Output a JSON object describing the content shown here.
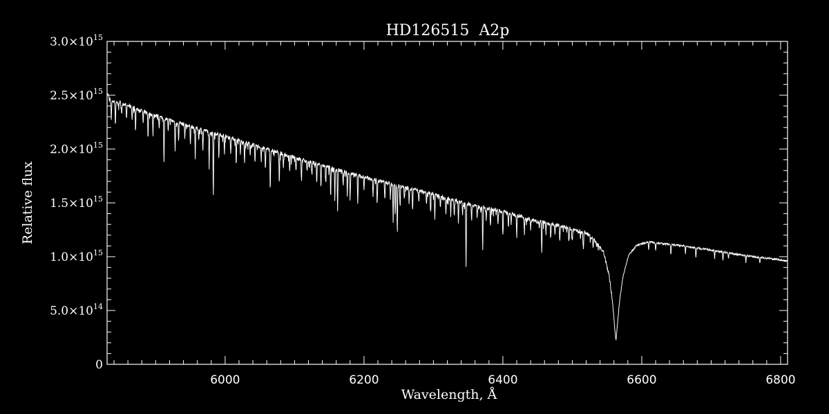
{
  "chart_data": {
    "type": "line",
    "title": "HD126515  A2p",
    "xlabel": "Wavelength, Å",
    "ylabel": "Relative flux",
    "xlim": [
      5830,
      6810
    ],
    "ylim": [
      0,
      3000000000000000.0
    ],
    "grid": false,
    "legend": "none",
    "x_ticks": [
      {
        "value": 6000,
        "label": "6000"
      },
      {
        "value": 6200,
        "label": "6200"
      },
      {
        "value": 6400,
        "label": "6400"
      },
      {
        "value": 6600,
        "label": "6600"
      },
      {
        "value": 6800,
        "label": "6800"
      }
    ],
    "x_minor_step": 20,
    "y_ticks": [
      {
        "value": 0,
        "mant": "0",
        "exp": ""
      },
      {
        "value": 500000000000000.0,
        "mant": "5.0×10",
        "exp": "14"
      },
      {
        "value": 1000000000000000.0,
        "mant": "1.0×10",
        "exp": "15"
      },
      {
        "value": 1500000000000000.0,
        "mant": "1.5×10",
        "exp": "15"
      },
      {
        "value": 2000000000000000.0,
        "mant": "2.0×10",
        "exp": "15"
      },
      {
        "value": 2500000000000000.0,
        "mant": "2.5×10",
        "exp": "15"
      },
      {
        "value": 3000000000000000.0,
        "mant": "3.0×10",
        "exp": "15"
      }
    ],
    "y_minor_step": 100000000000000.0,
    "series": [
      {
        "x": [
          5830,
          5835,
          5840,
          5850,
          5870,
          5890,
          5920,
          5950,
          6000,
          6050,
          6100,
          6150,
          6200,
          6250,
          6300,
          6350,
          6400,
          6450,
          6480,
          6500,
          6520,
          6535,
          6545,
          6553,
          6558,
          6561,
          6562.8,
          6564.5,
          6568,
          6573,
          6581,
          6592,
          6610,
          6630,
          6660,
          6700,
          6750,
          6800,
          6810
        ],
        "values": [
          2520000000000000.0,
          2450000000000000.0,
          2440000000000000.0,
          2430000000000000.0,
          2380000000000000.0,
          2330000000000000.0,
          2270000000000000.0,
          2210000000000000.0,
          2120000000000000.0,
          2020000000000000.0,
          1920000000000000.0,
          1830000000000000.0,
          1740000000000000.0,
          1660000000000000.0,
          1580000000000000.0,
          1490000000000000.0,
          1420000000000000.0,
          1330000000000000.0,
          1290000000000000.0,
          1250000000000000.0,
          1220000000000000.0,
          1140000000000000.0,
          1040000000000000.0,
          830000000000000.0,
          580000000000000.0,
          340000000000000.0,
          220000000000000.0,
          340000000000000.0,
          580000000000000.0,
          820000000000000.0,
          1010000000000000.0,
          1100000000000000.0,
          1140000000000000.0,
          1120000000000000.0,
          1100000000000000.0,
          1060000000000000.0,
          1010000000000000.0,
          970000000000000.0,
          960000000000000.0
        ]
      }
    ],
    "absorption_lines": [
      [
        5836,
        180000000000000.0
      ],
      [
        5842,
        220000000000000.0
      ],
      [
        5851,
        100000000000000.0
      ],
      [
        5858,
        150000000000000.0
      ],
      [
        5866,
        120000000000000.0
      ],
      [
        5871,
        200000000000000.0
      ],
      [
        5882,
        120000000000000.0
      ],
      [
        5889,
        230000000000000.0
      ],
      [
        5896,
        160000000000000.0
      ],
      [
        5905,
        100000000000000.0
      ],
      [
        5912,
        380000000000000.0
      ],
      [
        5918,
        120000000000000.0
      ],
      [
        5928,
        280000000000000.0
      ],
      [
        5933,
        180000000000000.0
      ],
      [
        5942,
        120000000000000.0
      ],
      [
        5950,
        150000000000000.0
      ],
      [
        5957,
        280000000000000.0
      ],
      [
        5962,
        100000000000000.0
      ],
      [
        5968,
        200000000000000.0
      ],
      [
        5977,
        320000000000000.0
      ],
      [
        5983,
        600000000000000.0
      ],
      [
        5991,
        220000000000000.0
      ],
      [
        5999,
        150000000000000.0
      ],
      [
        6008,
        120000000000000.0
      ],
      [
        6016,
        250000000000000.0
      ],
      [
        6022,
        120000000000000.0
      ],
      [
        6028,
        200000000000000.0
      ],
      [
        6036,
        100000000000000.0
      ],
      [
        6043,
        180000000000000.0
      ],
      [
        6052,
        120000000000000.0
      ],
      [
        6058,
        200000000000000.0
      ],
      [
        6065,
        380000000000000.0
      ],
      [
        6078,
        280000000000000.0
      ],
      [
        6084,
        120000000000000.0
      ],
      [
        6093,
        150000000000000.0
      ],
      [
        6102,
        120000000000000.0
      ],
      [
        6110,
        200000000000000.0
      ],
      [
        6118,
        100000000000000.0
      ],
      [
        6125,
        120000000000000.0
      ],
      [
        6132,
        180000000000000.0
      ],
      [
        6138,
        220000000000000.0
      ],
      [
        6145,
        160000000000000.0
      ],
      [
        6152,
        280000000000000.0
      ],
      [
        6158,
        300000000000000.0
      ],
      [
        6162,
        400000000000000.0
      ],
      [
        6170,
        150000000000000.0
      ],
      [
        6176,
        200000000000000.0
      ],
      [
        6180,
        250000000000000.0
      ],
      [
        6191,
        280000000000000.0
      ],
      [
        6200,
        120000000000000.0
      ],
      [
        6213,
        150000000000000.0
      ],
      [
        6219,
        200000000000000.0
      ],
      [
        6230,
        180000000000000.0
      ],
      [
        6238,
        140000000000000.0
      ],
      [
        6242,
        350000000000000.0
      ],
      [
        6245,
        300000000000000.0
      ],
      [
        6248,
        450000000000000.0
      ],
      [
        6252,
        200000000000000.0
      ],
      [
        6258,
        120000000000000.0
      ],
      [
        6265,
        150000000000000.0
      ],
      [
        6270,
        200000000000000.0
      ],
      [
        6279,
        120000000000000.0
      ],
      [
        6290,
        120000000000000.0
      ],
      [
        6296,
        180000000000000.0
      ],
      [
        6302,
        220000000000000.0
      ],
      [
        6310,
        120000000000000.0
      ],
      [
        6318,
        150000000000000.0
      ],
      [
        6325,
        120000000000000.0
      ],
      [
        6330,
        150000000000000.0
      ],
      [
        6336,
        200000000000000.0
      ],
      [
        6342,
        120000000000000.0
      ],
      [
        6347,
        600000000000000.0
      ],
      [
        6355,
        150000000000000.0
      ],
      [
        6363,
        120000000000000.0
      ],
      [
        6371,
        420000000000000.0
      ],
      [
        6376,
        120000000000000.0
      ],
      [
        6382,
        150000000000000.0
      ],
      [
        6393,
        120000000000000.0
      ],
      [
        6400,
        200000000000000.0
      ],
      [
        6408,
        150000000000000.0
      ],
      [
        6412,
        100000000000000.0
      ],
      [
        6420,
        180000000000000.0
      ],
      [
        6431,
        150000000000000.0
      ],
      [
        6440,
        100000000000000.0
      ],
      [
        6456,
        300000000000000.0
      ],
      [
        6462,
        100000000000000.0
      ],
      [
        6469,
        120000000000000.0
      ],
      [
        6475,
        100000000000000.0
      ],
      [
        6482,
        150000000000000.0
      ],
      [
        6495,
        120000000000000.0
      ],
      [
        6500,
        100000000000000.0
      ],
      [
        6516,
        150000000000000.0
      ],
      [
        6530,
        100000000000000.0
      ],
      [
        6610,
        80000000000000.0
      ],
      [
        6620,
        70000000000000.0
      ],
      [
        6642,
        100000000000000.0
      ],
      [
        6663,
        70000000000000.0
      ],
      [
        6678,
        100000000000000.0
      ],
      [
        6705,
        70000000000000.0
      ],
      [
        6717,
        80000000000000.0
      ],
      [
        6725,
        60000000000000.0
      ],
      [
        6750,
        70000000000000.0
      ],
      [
        6770,
        60000000000000.0
      ]
    ]
  }
}
